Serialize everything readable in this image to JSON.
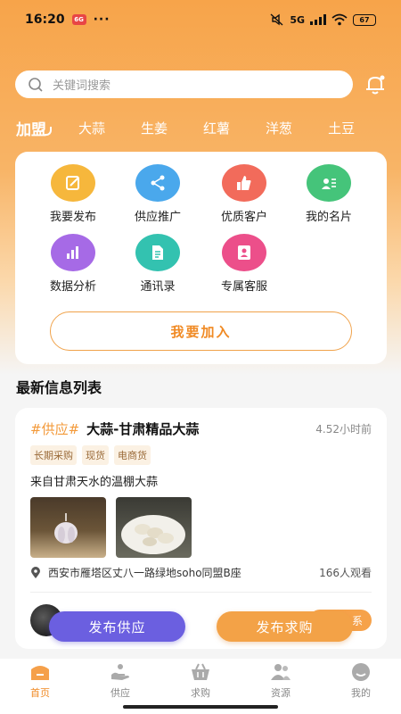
{
  "status": {
    "time": "16:20",
    "app_badge": "6G",
    "dots": "···",
    "network": "5G",
    "battery": "67"
  },
  "search": {
    "placeholder": "关键词搜索"
  },
  "categories": [
    "加盟",
    "大蒜",
    "生姜",
    "红薯",
    "洋葱",
    "土豆"
  ],
  "functions": [
    {
      "label": "我要发布",
      "icon": "edit-icon",
      "color": "#f6b73c"
    },
    {
      "label": "供应推广",
      "icon": "share-icon",
      "color": "#4aa8ec"
    },
    {
      "label": "优质客户",
      "icon": "thumbs-up-icon",
      "color": "#f26b5b"
    },
    {
      "label": "我的名片",
      "icon": "id-card-icon",
      "color": "#45c47a"
    },
    {
      "label": "数据分析",
      "icon": "bar-chart-icon",
      "color": "#a66ae6"
    },
    {
      "label": "通讯录",
      "icon": "document-icon",
      "color": "#33c2b0"
    },
    {
      "label": "专属客服",
      "icon": "agent-icon",
      "color": "#ec4f8a"
    }
  ],
  "join_label": "我要加入",
  "section_title": "最新信息列表",
  "post": {
    "tag": "#供应#",
    "title": "大蒜-甘肃精品大蒜",
    "time": "4.52小时前",
    "badges": [
      "长期采购",
      "现货",
      "电商货"
    ],
    "description": "来自甘肃天水的温棚大蒜",
    "location": "西安市雁塔区丈八一路绿地soho同盟B座",
    "views": "166人观看",
    "contact_label": "系"
  },
  "fab": {
    "supply": "发布供应",
    "demand": "发布求购"
  },
  "tabbar": [
    {
      "label": "首页",
      "icon": "home-icon",
      "active": true
    },
    {
      "label": "供应",
      "icon": "supply-icon",
      "active": false
    },
    {
      "label": "求购",
      "icon": "basket-icon",
      "active": false
    },
    {
      "label": "资源",
      "icon": "people-icon",
      "active": false
    },
    {
      "label": "我的",
      "icon": "profile-icon",
      "active": false
    }
  ],
  "colors": {
    "accent": "#f08a24",
    "supply_button": "#6b5fe0",
    "demand_button": "#f3a247"
  }
}
